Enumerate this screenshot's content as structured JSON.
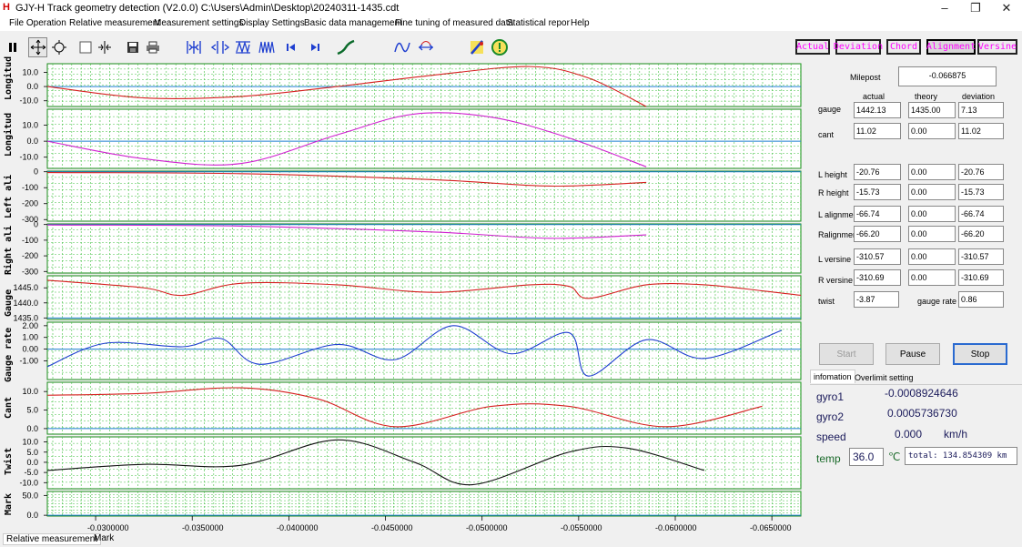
{
  "window": {
    "title": "GJY-H Track geometry detection (V2.0.0)    C:\\Users\\Admin\\Desktop\\20240311-1435.cdt",
    "app_icon": "H",
    "minimize": "–",
    "maximize": "❐",
    "close": "✕"
  },
  "menu": [
    "File Operation",
    "Relative measurement",
    "Measurement settings",
    "Display Settings",
    "Basic data management",
    "Fine tuning of measured data",
    "Statistical repor",
    "Help"
  ],
  "mode_buttons": [
    "Actual",
    "Deviation",
    "Chord",
    "Alignment",
    "Versine"
  ],
  "active_mode": "Alignment",
  "plots": [
    {
      "label": "Longitud",
      "ticks": [
        "10.0",
        "0.0",
        "-10.0"
      ]
    },
    {
      "label": "Longitud",
      "ticks": [
        "10.0",
        "0.0",
        "-10.0"
      ]
    },
    {
      "label": "Left ali",
      "ticks": [
        "0",
        "-100",
        "-200",
        "-300"
      ]
    },
    {
      "label": "Right ali",
      "ticks": [
        "0",
        "-100",
        "-200",
        "-300"
      ]
    },
    {
      "label": "Gauge",
      "ticks": [
        "1445.0",
        "1440.0",
        "1435.0"
      ]
    },
    {
      "label": "Gauge rate",
      "ticks": [
        "2.00",
        "1.00",
        "0.00",
        "-1.00"
      ]
    },
    {
      "label": "Cant",
      "ticks": [
        "10.0",
        "5.0",
        "0.0"
      ]
    },
    {
      "label": "Twist",
      "ticks": [
        "10.0",
        "5.0",
        "0.0",
        "-5.0",
        "-10.0"
      ]
    },
    {
      "label": "Mark",
      "ticks": [
        "50.0",
        "0.0"
      ]
    }
  ],
  "x_ticks": [
    "-0.0300000",
    "-0.0350000",
    "-0.0400000",
    "-0.0450000",
    "-0.0500000",
    "-0.0550000",
    "-0.0600000",
    "-0.0650000"
  ],
  "chart_data": {
    "type": "line",
    "x_axis": {
      "label": "",
      "range": [
        -0.0275,
        -0.0665
      ],
      "ticks": [
        -0.03,
        -0.035,
        -0.04,
        -0.045,
        -0.05,
        -0.055,
        -0.06,
        -0.065
      ]
    },
    "series": [
      {
        "panel": "Longitud (1)",
        "color": "#d62020",
        "x": [
          -0.0275,
          -0.0325,
          -0.0375,
          -0.0425,
          -0.0475,
          -0.0525,
          -0.0555,
          -0.0585
        ],
        "y": [
          0,
          -8,
          -7,
          0,
          8,
          14,
          6,
          -14
        ]
      },
      {
        "panel": "Longitud (2)",
        "color": "#d020d0",
        "x": [
          -0.0275,
          -0.0325,
          -0.0375,
          -0.0425,
          -0.0465,
          -0.0505,
          -0.0545,
          -0.0585
        ],
        "y": [
          0,
          -11,
          -14,
          4,
          17,
          15,
          2,
          -16
        ]
      },
      {
        "panel": "Left ali",
        "color": "#d62020",
        "x": [
          -0.0275,
          -0.0375,
          -0.0475,
          -0.0535,
          -0.0585
        ],
        "y": [
          -5,
          -12,
          -50,
          -90,
          -66.74
        ]
      },
      {
        "panel": "Right ali",
        "color": "#d020d0",
        "x": [
          -0.0275,
          -0.0375,
          -0.0475,
          -0.0535,
          -0.0585
        ],
        "y": [
          -3,
          -10,
          -48,
          -88,
          -66.2
        ]
      },
      {
        "panel": "Gauge",
        "color": "#d62020",
        "x": [
          -0.0275,
          -0.0325,
          -0.0345,
          -0.0375,
          -0.0425,
          -0.0475,
          -0.0525,
          -0.0545,
          -0.0555,
          -0.0585,
          -0.0615,
          -0.0645,
          -0.0665
        ],
        "y": [
          1447.5,
          1445,
          1442.5,
          1446.5,
          1446,
          1443.5,
          1446,
          1445.5,
          1441.5,
          1446,
          1446,
          1444,
          1442.5
        ]
      },
      {
        "panel": "Gauge rate",
        "color": "#1f3fd0",
        "x": [
          -0.0275,
          -0.0305,
          -0.0345,
          -0.0365,
          -0.0385,
          -0.0425,
          -0.0455,
          -0.0485,
          -0.0515,
          -0.0545,
          -0.0555,
          -0.0585,
          -0.0615,
          -0.0655
        ],
        "y": [
          -1.5,
          0.5,
          0.2,
          0.9,
          -1.3,
          0.4,
          -0.9,
          2.0,
          -0.4,
          1.4,
          -2.3,
          0.8,
          -0.8,
          1.6
        ]
      },
      {
        "panel": "Cant",
        "color": "#d62020",
        "x": [
          -0.0275,
          -0.0325,
          -0.0375,
          -0.0415,
          -0.0455,
          -0.0505,
          -0.0545,
          -0.0595,
          -0.0645
        ],
        "y": [
          9,
          9.5,
          11,
          8,
          0.5,
          6,
          6,
          0.5,
          6
        ]
      },
      {
        "panel": "Twist",
        "color": "#111111",
        "x": [
          -0.0275,
          -0.0325,
          -0.0375,
          -0.0425,
          -0.0465,
          -0.0495,
          -0.0545,
          -0.0575,
          -0.0615
        ],
        "y": [
          -4,
          -1,
          -1.5,
          11,
          0,
          -11,
          5,
          7,
          -4
        ]
      }
    ]
  },
  "panel": {
    "milepost_label": "Milepost",
    "milepost_value": "-0.066875",
    "col_headers": [
      "actual",
      "theory",
      "deviation"
    ],
    "rows": [
      {
        "label": "gauge",
        "actual": "1442.13",
        "theory": "1435.00",
        "deviation": "7.13"
      },
      {
        "label": "cant",
        "actual": "11.02",
        "theory": "0.00",
        "deviation": "11.02"
      },
      {
        "label": "L height",
        "actual": "-20.76",
        "theory": "0.00",
        "deviation": "-20.76"
      },
      {
        "label": "R height",
        "actual": "-15.73",
        "theory": "0.00",
        "deviation": "-15.73"
      },
      {
        "label": "L alignment",
        "actual": "-66.74",
        "theory": "0.00",
        "deviation": "-66.74"
      },
      {
        "label": "Ralignment",
        "actual": "-66.20",
        "theory": "0.00",
        "deviation": "-66.20"
      },
      {
        "label": "L versine",
        "actual": "-310.57",
        "theory": "0.00",
        "deviation": "-310.57"
      },
      {
        "label": "R versine",
        "actual": "-310.69",
        "theory": "0.00",
        "deviation": "-310.69"
      }
    ],
    "twist_label": "twist",
    "twist_value": "-3.87",
    "gauge_rate_label": "gauge rate",
    "gauge_rate_value": "0.86",
    "start": "Start",
    "pause": "Pause",
    "stop": "Stop",
    "tabs": [
      "infomation",
      "Overlimit setting"
    ],
    "gyro1_label": "gyro1",
    "gyro1_value": "-0.0008924646",
    "gyro2_label": "gyro2",
    "gyro2_value": "0.0005736730",
    "speed_label": "speed",
    "speed_value": "0.000",
    "speed_unit": "km/h",
    "temp_label": "temp",
    "temp_value": "36.0",
    "temp_unit": "℃",
    "total_label": "total: 134.854309 km"
  },
  "status_tabs": [
    "Relative measurement",
    "Mark"
  ]
}
